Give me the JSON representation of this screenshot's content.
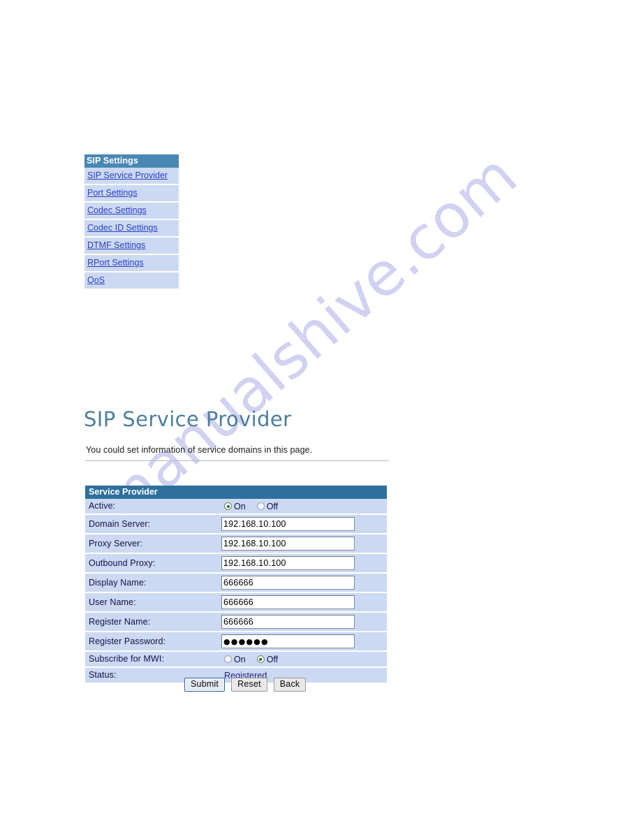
{
  "watermark": {
    "text": "manualshive.com"
  },
  "sidebar": {
    "title": "SIP Settings",
    "items": [
      {
        "label": "SIP Service Provider"
      },
      {
        "label": "Port Settings"
      },
      {
        "label": "Codec Settings"
      },
      {
        "label": "Codec ID Settings"
      },
      {
        "label": "DTMF Settings"
      },
      {
        "label": "RPort Settings"
      },
      {
        "label": "QoS"
      }
    ]
  },
  "page": {
    "title": "SIP Service Provider",
    "subtitle": "You could set information of service domains in this page."
  },
  "form": {
    "header": "Service Provider",
    "rows": [
      {
        "label": "Active:",
        "type": "radio",
        "options": [
          {
            "label": "On",
            "checked": true
          },
          {
            "label": "Off",
            "checked": false
          }
        ]
      },
      {
        "label": "Domain Server:",
        "type": "text",
        "value": "192.168.10.100"
      },
      {
        "label": "Proxy Server:",
        "type": "text",
        "value": "192.168.10.100"
      },
      {
        "label": "Outbound Proxy:",
        "type": "text",
        "value": "192.168.10.100"
      },
      {
        "label": "Display Name:",
        "type": "text",
        "value": "666666"
      },
      {
        "label": "User Name:",
        "type": "text",
        "value": "666666"
      },
      {
        "label": "Register Name:",
        "type": "text",
        "value": "666666"
      },
      {
        "label": "Register Password:",
        "type": "password",
        "value": "●●●●●●"
      },
      {
        "label": "Subscribe for MWI:",
        "type": "radio",
        "options": [
          {
            "label": "On",
            "checked": false
          },
          {
            "label": "Off",
            "checked": true
          }
        ]
      },
      {
        "label": "Status:",
        "type": "status",
        "value": "Registered"
      }
    ]
  },
  "buttons": [
    {
      "label": "Submit",
      "focused": true
    },
    {
      "label": "Reset",
      "focused": false
    },
    {
      "label": "Back",
      "focused": false
    }
  ],
  "colors": {
    "menu_header": "#4a87b4",
    "table_header": "#2e6f9e",
    "row_background": "#ccd9f2",
    "link": "#2b3fc8",
    "title": "#4d7f9e",
    "status": "#20207a",
    "watermark": "#c9cbef"
  }
}
